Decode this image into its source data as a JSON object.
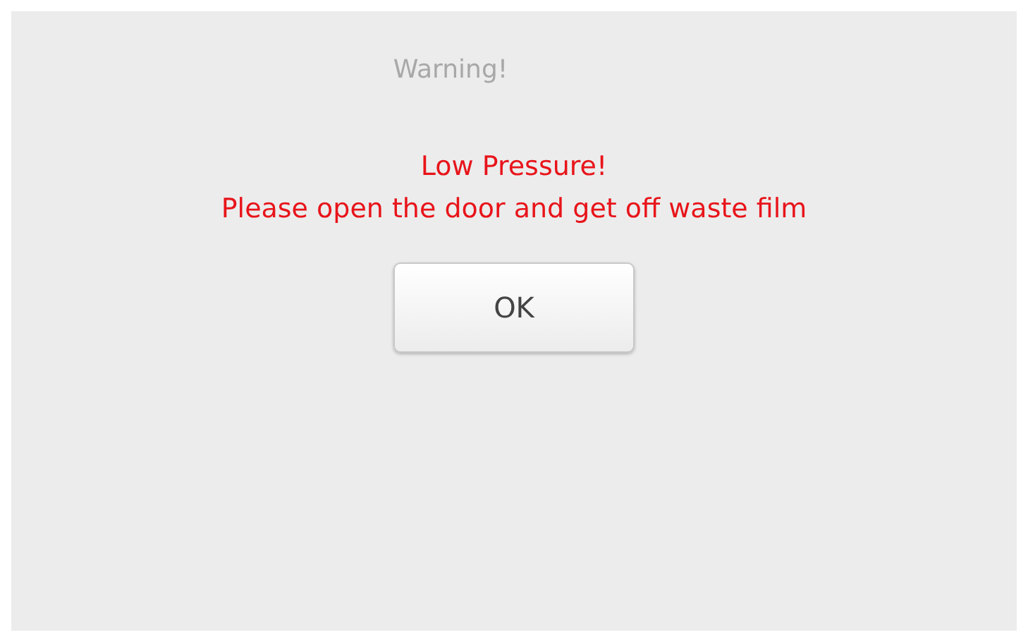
{
  "dialog": {
    "title": "Warning!",
    "message_lines": [
      "Low Pressure!",
      "Please open the door and get off waste film"
    ],
    "buttons": [
      "OK"
    ]
  }
}
